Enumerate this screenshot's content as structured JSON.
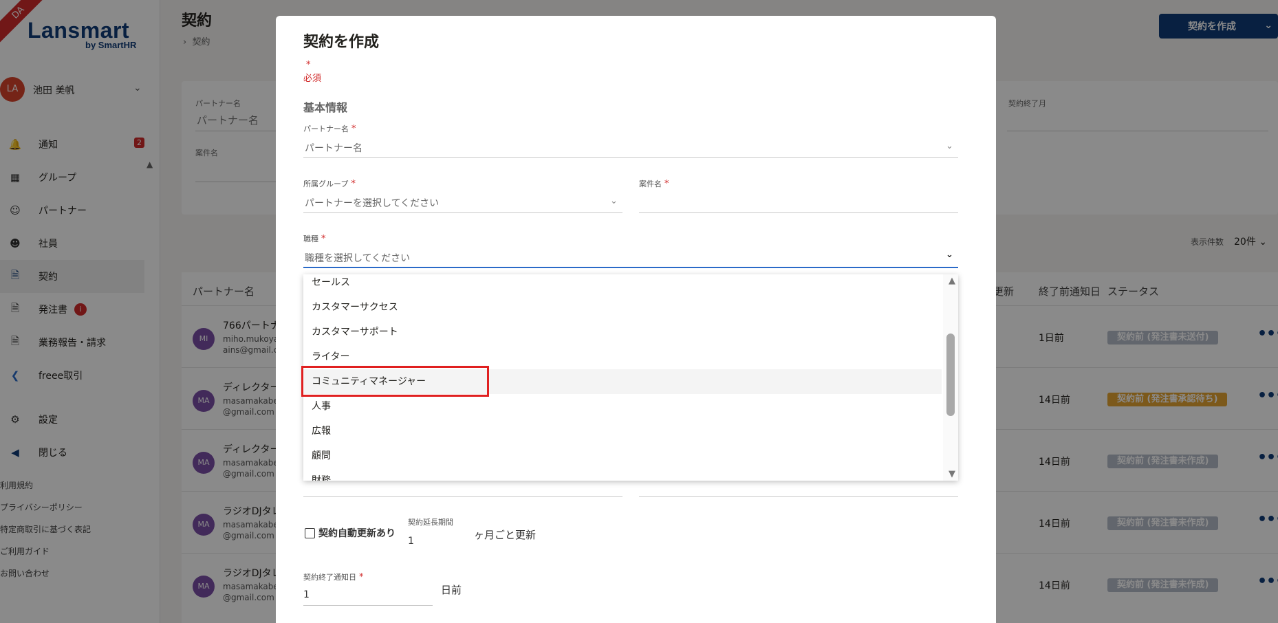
{
  "sidebar": {
    "ribbon": "DA",
    "logo": "Lansmart",
    "logo_by": "by SmartHR",
    "user": {
      "avatar": "LA",
      "name": "池田 美帆"
    },
    "nav": [
      {
        "label": "通知",
        "badge": "2"
      },
      {
        "label": "グループ"
      },
      {
        "label": "パートナー"
      },
      {
        "label": "社員"
      },
      {
        "label": "契約"
      },
      {
        "label": "発注書",
        "info": "i"
      },
      {
        "label": "業務報告・請求"
      },
      {
        "label": "freee取引"
      },
      {
        "label": "設定"
      },
      {
        "label": "閉じる"
      }
    ],
    "footer": [
      "利用規約",
      "プライバシーポリシー",
      "特定商取引に基づく表記",
      "ご利用ガイド",
      "お問い合わせ"
    ]
  },
  "header": {
    "title": "契約",
    "breadcrumb": "契約",
    "create_button": "契約を作成"
  },
  "filters": {
    "partner_label": "パートナー名",
    "partner_placeholder": "パートナー名",
    "project_label": "案件名",
    "end_month_label": "契約終了月"
  },
  "pagination": {
    "label": "表示件数",
    "value": "20件"
  },
  "table": {
    "headers": {
      "partner": "パートナー名",
      "renew": "更新",
      "notice": "終了前通知日",
      "status": "ステータス"
    },
    "rows": [
      {
        "avatar": "MI",
        "name": "766パートナ",
        "email1": "miho.mukoya",
        "email2": "ains@gmail.co",
        "days": "1日前",
        "status": "契約前 (発注書未送付)",
        "status_color": "#b6bcc9"
      },
      {
        "avatar": "MA",
        "name": "ディレクター",
        "email1": "masamakabe",
        "email2": "@gmail.com",
        "days": "14日前",
        "status": "契約前 (発注書承認待ち)",
        "status_color": "#e6a532"
      },
      {
        "avatar": "MA",
        "name": "ディレクター",
        "email1": "masamakabe",
        "email2": "@gmail.com",
        "days": "14日前",
        "status": "契約前 (発注書未作成)",
        "status_color": "#b6bcc9"
      },
      {
        "avatar": "MA",
        "name": "ラジオDJタレ",
        "email1": "masamakabe",
        "email2": "@gmail.com",
        "days": "14日前",
        "status": "契約前 (発注書未作成)",
        "status_color": "#b6bcc9"
      },
      {
        "avatar": "MA",
        "name": "ラジオDJタレ",
        "email1": "masamakabe",
        "email2": "@gmail.com",
        "days": "14日前",
        "status": "契約前 (発注書未作成)",
        "status_color": "#b6bcc9"
      }
    ]
  },
  "modal": {
    "title": "契約を作成",
    "required_star": "*",
    "required_text": "必須",
    "section": "基本情報",
    "partner": {
      "label": "パートナー名",
      "placeholder": "パートナー名"
    },
    "group": {
      "label": "所属グループ",
      "placeholder": "パートナーを選択してください"
    },
    "project": {
      "label": "案件名",
      "value": ""
    },
    "job": {
      "label": "職種",
      "placeholder": "職種を選択してください"
    },
    "job_options": [
      "セールス",
      "カスタマーサクセス",
      "カスタマーサポート",
      "ライター",
      "コミュニティマネージャー",
      "人事",
      "広報",
      "顧問",
      "財務"
    ],
    "auto_renew_label": "契約自動更新あり",
    "extension": {
      "label": "契約延長期間",
      "value": "1",
      "suffix": "ヶ月ごと更新"
    },
    "end_notice": {
      "label": "契約終了通知日",
      "value": "1",
      "suffix": "日前"
    }
  }
}
